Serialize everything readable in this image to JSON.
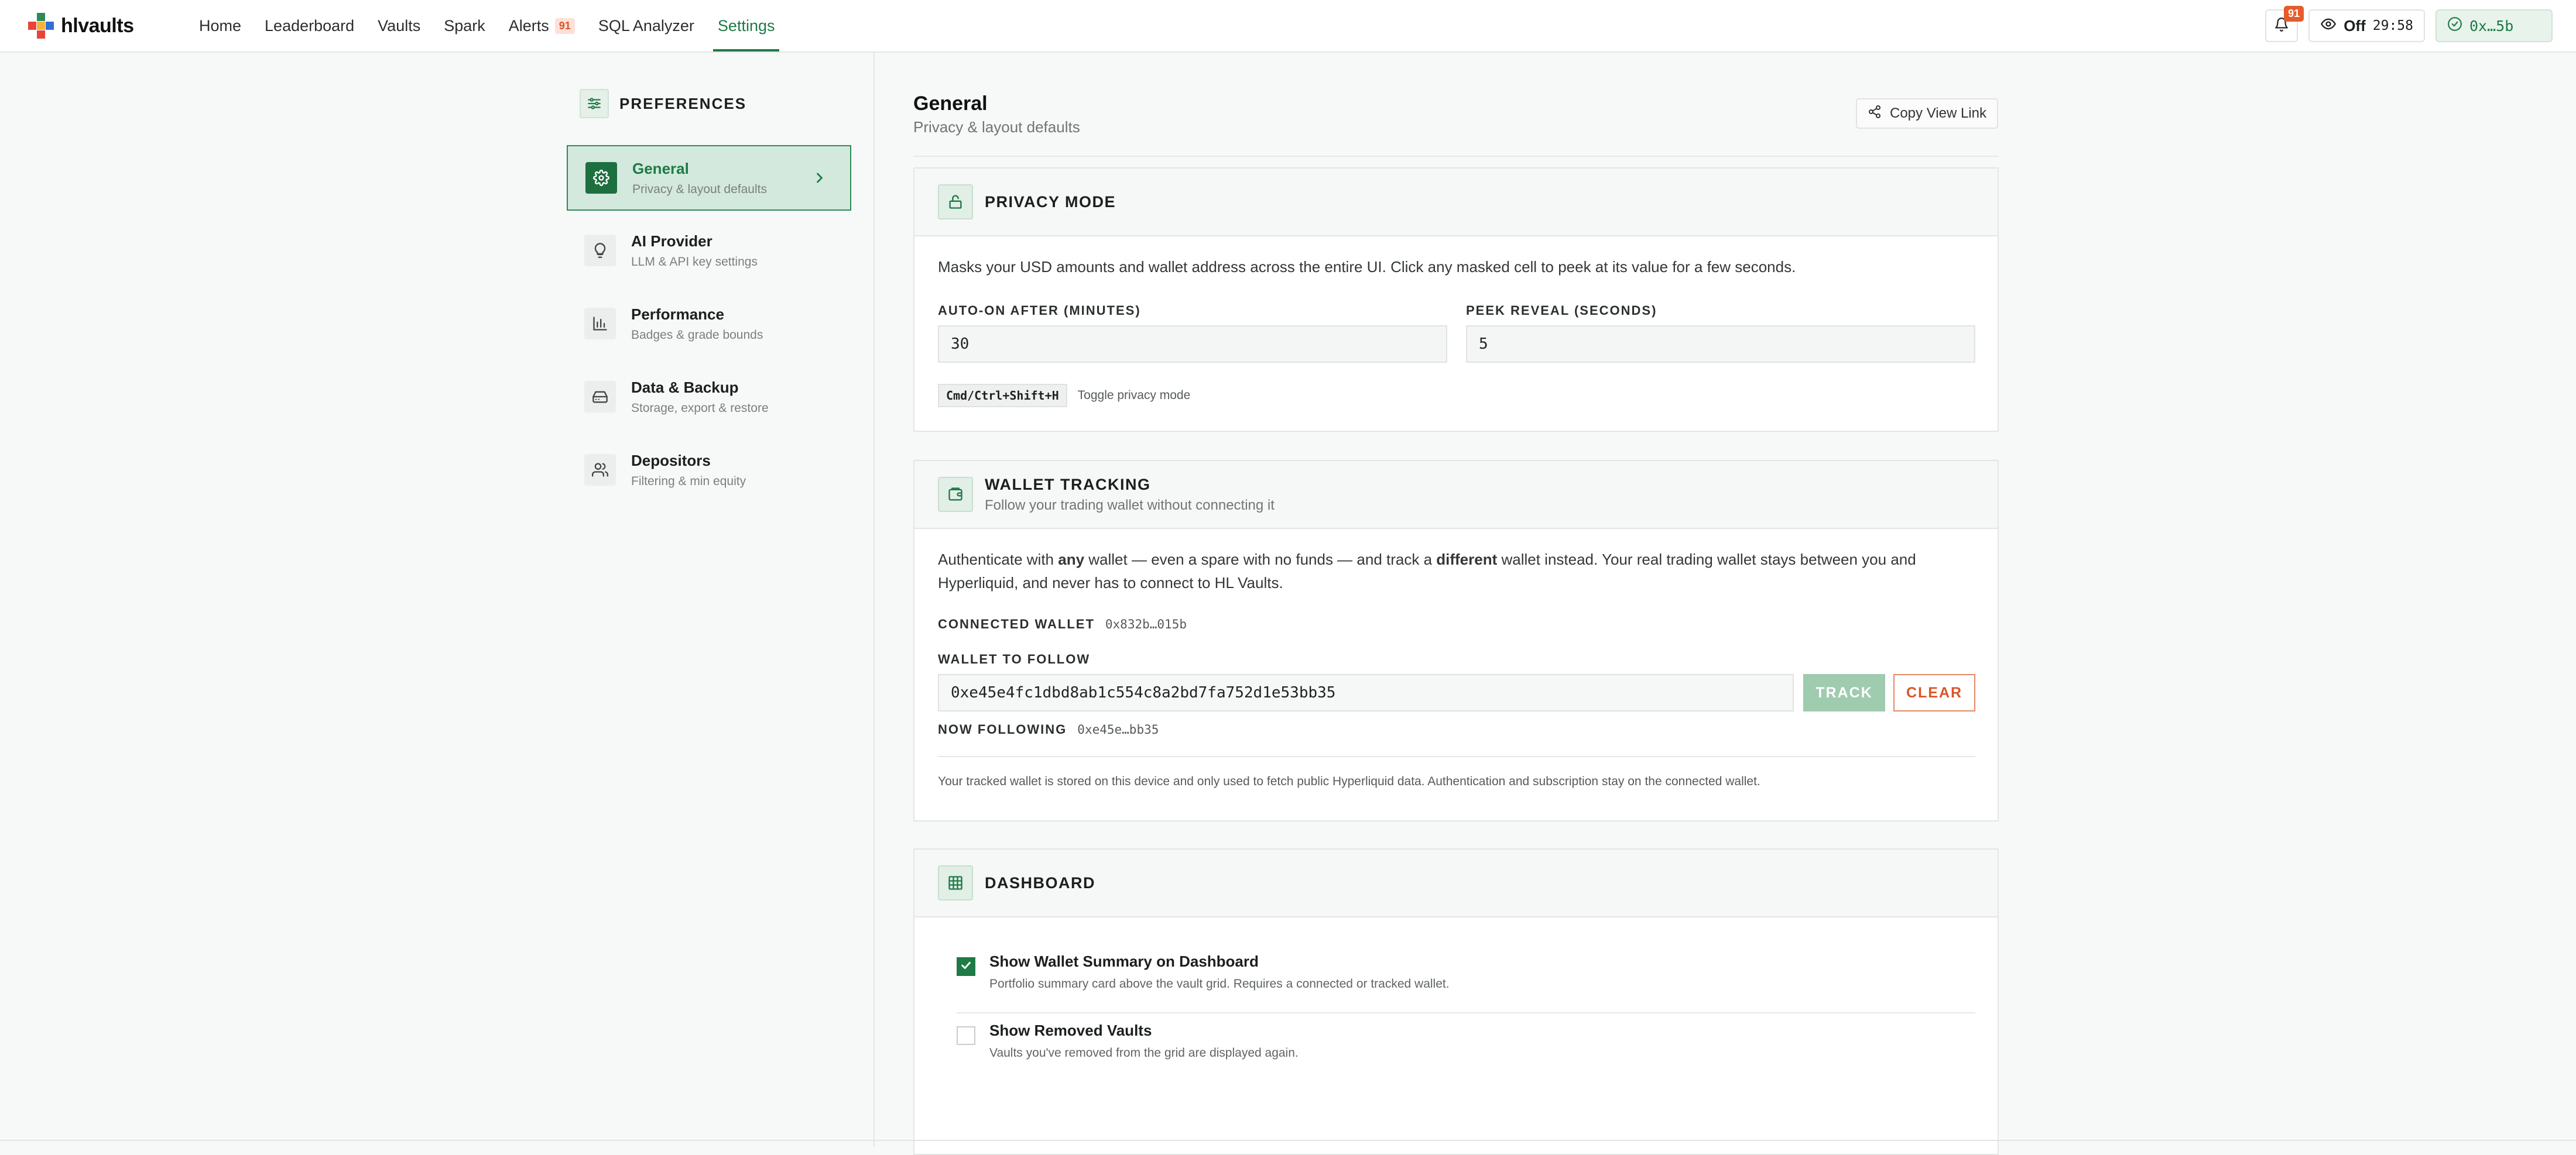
{
  "app": {
    "name": "hlvaults",
    "colors": {
      "accent": "#1e7a46",
      "accent_light": "#d4e9dd",
      "alert": "#e55b2b"
    }
  },
  "nav": {
    "items": [
      {
        "label": "Home"
      },
      {
        "label": "Leaderboard"
      },
      {
        "label": "Vaults"
      },
      {
        "label": "Spark"
      },
      {
        "label": "Alerts",
        "badge": "91"
      },
      {
        "label": "SQL Analyzer"
      },
      {
        "label": "Settings",
        "active": true
      }
    ]
  },
  "topbar": {
    "notifications_badge": "91",
    "privacy_state": "Off",
    "privacy_timer": "29:58",
    "wallet_short": "0x…5b"
  },
  "sidebar": {
    "title": "PREFERENCES",
    "items": [
      {
        "label": "General",
        "sub": "Privacy & layout defaults",
        "icon": "gear-icon",
        "active": true
      },
      {
        "label": "AI Provider",
        "sub": "LLM & API key settings",
        "icon": "lightbulb-icon"
      },
      {
        "label": "Performance",
        "sub": "Badges & grade bounds",
        "icon": "bar-chart-icon"
      },
      {
        "label": "Data & Backup",
        "sub": "Storage, export & restore",
        "icon": "drive-icon"
      },
      {
        "label": "Depositors",
        "sub": "Filtering & min equity",
        "icon": "users-icon"
      }
    ]
  },
  "page": {
    "title": "General",
    "subtitle": "Privacy & layout defaults",
    "copy_link_label": "Copy View Link"
  },
  "privacy": {
    "title": "PRIVACY MODE",
    "description": "Masks your USD amounts and wallet address across the entire UI. Click any masked cell to peek at its value for a few seconds.",
    "auto_on_label": "AUTO-ON AFTER (MINUTES)",
    "auto_on_value": "30",
    "peek_label": "PEEK REVEAL (SECONDS)",
    "peek_value": "5",
    "shortcut": "Cmd/Ctrl+Shift+H",
    "shortcut_desc": "Toggle privacy mode"
  },
  "wallet": {
    "title": "WALLET TRACKING",
    "subtitle": "Follow your trading wallet without connecting it",
    "desc_1": "Authenticate with ",
    "desc_any": "any",
    "desc_2": " wallet — even a spare with no funds — and track a ",
    "desc_different": "different",
    "desc_3": " wallet instead. Your real trading wallet stays between you and Hyperliquid, and never has to connect to HL Vaults.",
    "connected_label": "CONNECTED WALLET",
    "connected_value": "0x832b…015b",
    "follow_label": "WALLET TO FOLLOW",
    "follow_value": "0xe45e4fc1dbd8ab1c554c8a2bd7fa752d1e53bb35",
    "track_label": "TRACK",
    "clear_label": "CLEAR",
    "now_following_label": "NOW FOLLOWING",
    "now_following_value": "0xe45e…bb35",
    "footnote": "Your tracked wallet is stored on this device and only used to fetch public Hyperliquid data. Authentication and subscription stay on the connected wallet."
  },
  "dashboard": {
    "title": "DASHBOARD",
    "options": [
      {
        "label": "Show Wallet Summary on Dashboard",
        "sub": "Portfolio summary card above the vault grid. Requires a connected or tracked wallet.",
        "checked": true
      },
      {
        "label": "Show Removed Vaults",
        "sub": "Vaults you've removed from the grid are displayed again.",
        "checked": false
      }
    ]
  }
}
